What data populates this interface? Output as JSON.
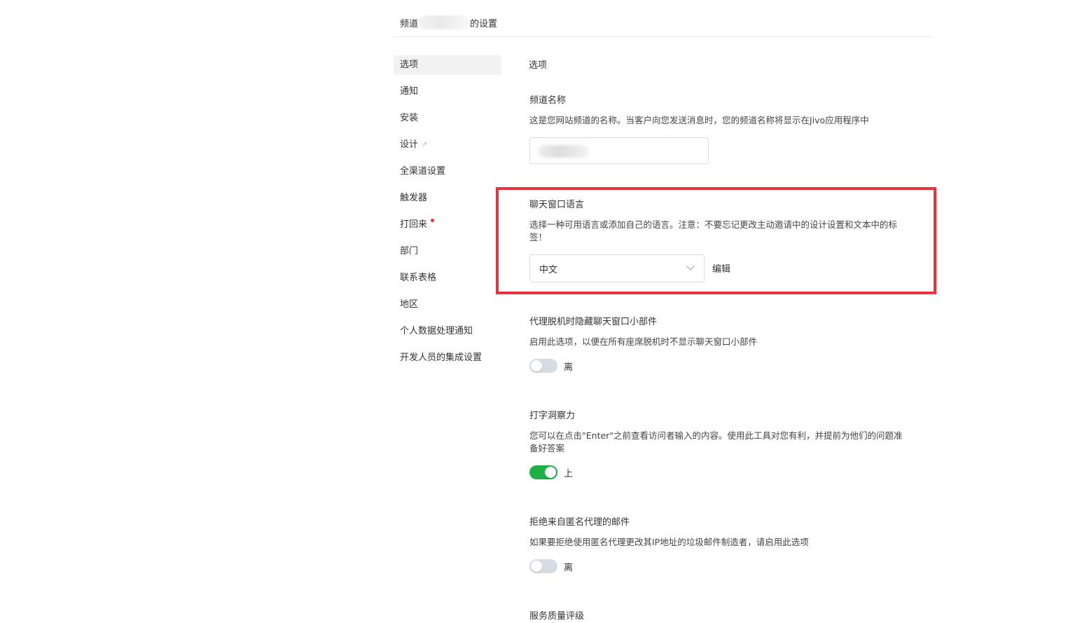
{
  "header": {
    "title_prefix": "频道",
    "title_suffix": "的设置"
  },
  "sidebar": {
    "items": [
      {
        "label": "选项"
      },
      {
        "label": "通知"
      },
      {
        "label": "安装"
      },
      {
        "label": "设计"
      },
      {
        "label": "全渠道设置"
      },
      {
        "label": "触发器"
      },
      {
        "label": "打回来"
      },
      {
        "label": "部门"
      },
      {
        "label": "联系表格"
      },
      {
        "label": "地区"
      },
      {
        "label": "个人数据处理通知"
      },
      {
        "label": "开发人员的集成设置"
      }
    ],
    "active_index": 0
  },
  "main": {
    "heading": "选项",
    "channel_name": {
      "label": "频道名称",
      "description": "这是您网站频道的名称。当客户向您发送消息时，您的频道名称将显示在Jivo应用程序中"
    },
    "chat_language": {
      "label": "聊天窗口语言",
      "description": "选择一种可用语言或添加自己的语言。注意：不要忘记更改主动邀请中的设计设置和文本中的标签！",
      "selected": "中文",
      "edit_label": "编辑"
    },
    "hide_offline": {
      "label": "代理脱机时隐藏聊天窗口小部件",
      "description": "启用此选项，以便在所有座席脱机时不显示聊天窗口小部件",
      "state": "离",
      "on": false
    },
    "typing_insight": {
      "label": "打字洞察力",
      "description": "您可以在点击\"Enter\"之前查看访问者输入的内容。使用此工具对您有利，并提前为他们的问题准备好答案",
      "state": "上",
      "on": true
    },
    "reject_proxy": {
      "label": "拒绝来自匿名代理的邮件",
      "description": "如果要拒绝使用匿名代理更改其IP地址的垃圾邮件制造者，请启用此选项",
      "state": "离",
      "on": false
    },
    "service_rating": {
      "label": "服务质量评级"
    }
  },
  "colors": {
    "highlight": "#e8323c",
    "toggle_on": "#1cb045",
    "toggle_off": "#d5dce4",
    "notification_dot": "#e5323b"
  }
}
